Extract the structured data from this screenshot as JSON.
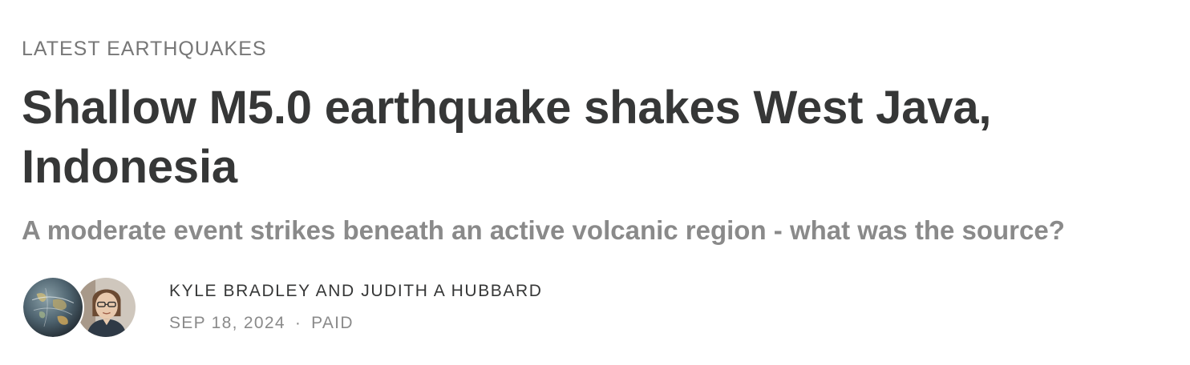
{
  "section": {
    "label": "LATEST EARTHQUAKES"
  },
  "post": {
    "title": "Shallow M5.0 earthquake shakes West Java, Indonesia",
    "subtitle": "A moderate event strikes beneath an active volcanic region - what was the source?"
  },
  "byline": {
    "authors": "KYLE BRADLEY AND JUDITH A HUBBARD",
    "date": "SEP 18, 2024",
    "separator": "·",
    "access": "PAID",
    "avatars": [
      {
        "icon": "globe-avatar-icon",
        "alt": "Kyle Bradley"
      },
      {
        "icon": "person-avatar-icon",
        "alt": "Judith A Hubbard"
      }
    ]
  },
  "colors": {
    "title": "#363737",
    "muted": "#8a8a8a",
    "section": "#777777",
    "background": "#ffffff"
  }
}
